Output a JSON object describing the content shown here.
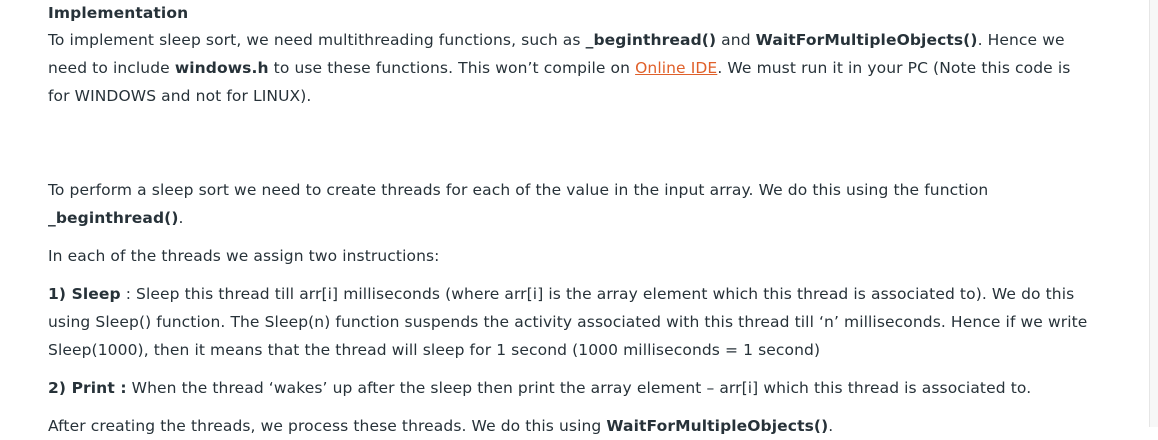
{
  "heading": "Implementation",
  "p1": {
    "t1": "To implement sleep sort, we need multithreading functions, such as ",
    "b1": "_beginthread()",
    "t2": " and ",
    "b2": "WaitForMultipleObjects()",
    "t3": ". Hence we need to include ",
    "b3": "windows.h",
    "t4": " to use these functions. This won’t compile on ",
    "link": "Online IDE",
    "t5": ". We must run it in your PC (Note this code is for WINDOWS and not for LINUX)."
  },
  "p2": {
    "t1": "To perform a sleep sort we need to create threads for each of the value in the input array. We do this using the function ",
    "b1": "_beginthread()",
    "t2": "."
  },
  "p3": {
    "t1": "In each of the threads we assign two instructions:"
  },
  "p4": {
    "b1": "1) Sleep",
    "t1": " : Sleep this thread till arr[i] milliseconds (where arr[i] is the array element which this thread is associated to). We do this using Sleep() function. The Sleep(n) function suspends the activity associated with this thread till ‘n’ milliseconds. Hence if we write Sleep(1000), then it means that the thread will sleep for 1 second (1000 milliseconds = 1 second)"
  },
  "p5": {
    "b1": "2) Print :",
    "t1": " When the thread ‘wakes’ up after the sleep then print the array element – arr[i] which this thread is associated to."
  },
  "p6": {
    "t1": "After creating the threads, we process these threads. We do this using ",
    "b1": "WaitForMultipleObjects()",
    "t2": "."
  }
}
